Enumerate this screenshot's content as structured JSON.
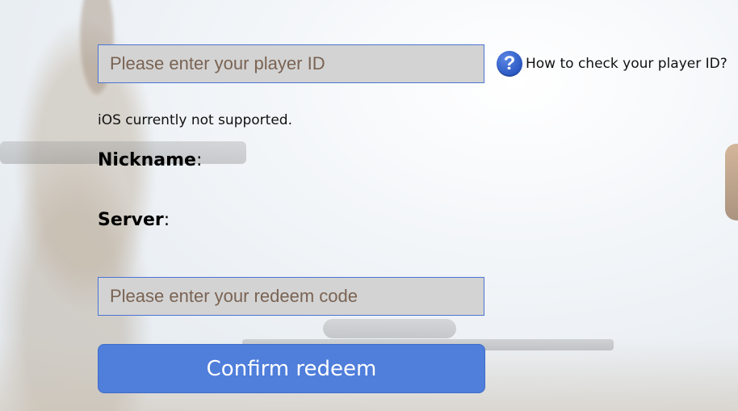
{
  "player_id": {
    "placeholder": "Please enter your player ID",
    "value": ""
  },
  "help": {
    "icon": "question-mark-icon",
    "glyph": "?",
    "text": "How to check your player ID?"
  },
  "notice": "iOS currently not supported.",
  "nickname": {
    "label": "Nickname",
    "separator": ":",
    "value": ""
  },
  "server": {
    "label": "Server",
    "separator": ":",
    "value": ""
  },
  "redeem_code": {
    "placeholder": "Please enter your redeem code",
    "value": ""
  },
  "confirm_label": "Confirm redeem",
  "colors": {
    "accent": "#4f7edb",
    "input_border": "#4a74d1",
    "input_bg": "#d3d3d3",
    "placeholder": "#7a6353"
  }
}
